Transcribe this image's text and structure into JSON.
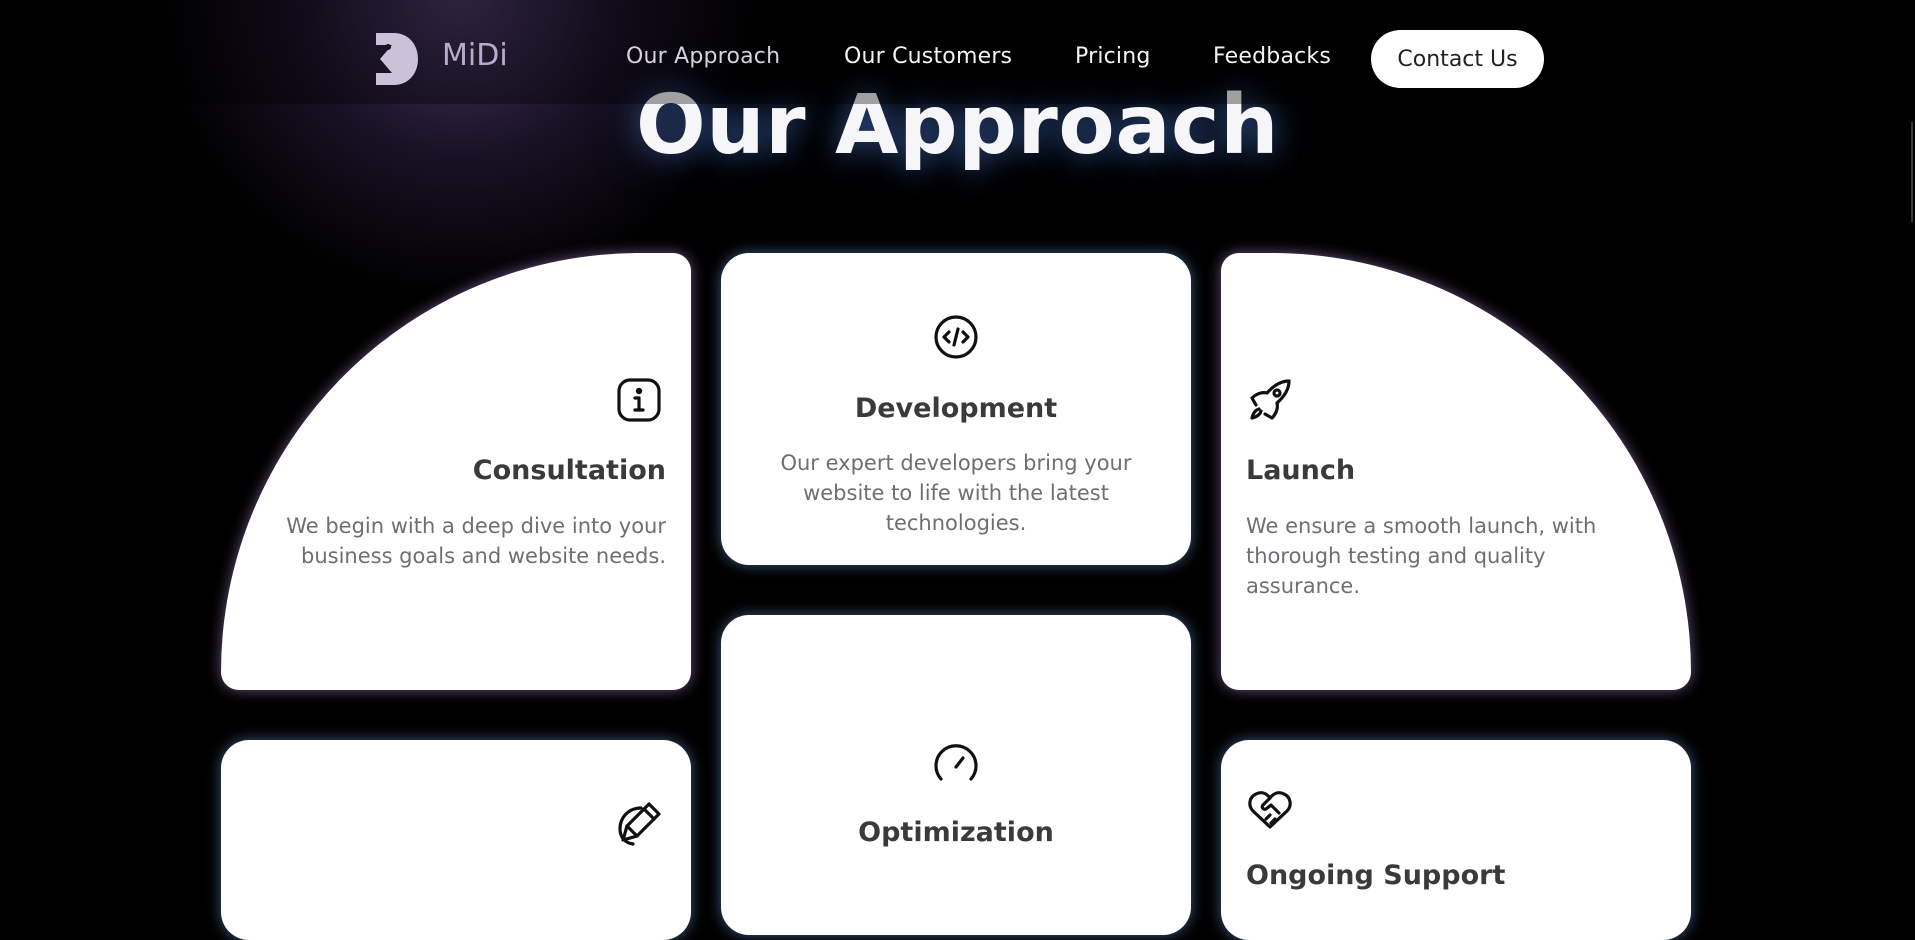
{
  "header": {
    "logo_text": "MiDi",
    "nav": [
      {
        "label": "Our Approach"
      },
      {
        "label": "Our Customers"
      },
      {
        "label": "Pricing"
      },
      {
        "label": "Feedbacks"
      }
    ],
    "contact_label": "Contact Us"
  },
  "hero": {
    "title": "Our Approach"
  },
  "cards": [
    {
      "title": "Consultation",
      "description": "We begin with a deep dive into your business goals and website needs.",
      "icon": "info-icon"
    },
    {
      "title": "Development",
      "description": "Our expert developers bring your website to life with the latest technologies.",
      "icon": "code-icon"
    },
    {
      "title": "Launch",
      "description": "We ensure a smooth launch, with thorough testing and quality assurance.",
      "icon": "rocket-icon"
    },
    {
      "title": "",
      "description": "",
      "icon": "pencil-icon"
    },
    {
      "title": "Optimization",
      "description": "",
      "icon": "speedometer-icon"
    },
    {
      "title": "Ongoing Support",
      "description": "",
      "icon": "heart-handshake-icon"
    }
  ],
  "colors": {
    "background": "#000000",
    "card": "#ffffff",
    "title_text": "#3a3a3a",
    "body_text": "#6f6f73",
    "logo_text": "#b7abcc"
  }
}
